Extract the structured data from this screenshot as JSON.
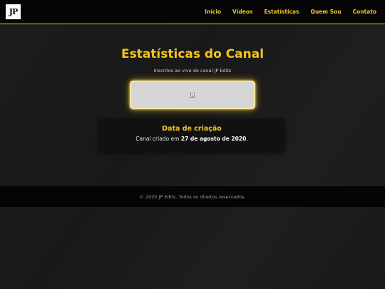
{
  "nav": {
    "logo_text": "JP",
    "links": [
      "Início",
      "Vídeos",
      "Estatísticas",
      "Quem Sou",
      "Contato"
    ]
  },
  "hero": {
    "title": "Estatísticas do Canal",
    "subtitle": "Inscritos ao vivo do canal JP Edits"
  },
  "counter": {
    "icon": "broken-image-icon"
  },
  "card": {
    "title": "Data de criação",
    "text_prefix": "Canal criado em ",
    "date": "27 de agosto de 2020",
    "text_suffix": "."
  },
  "footer": {
    "text": "© 2025 JP Edits. Todos os direitos reservados."
  },
  "colors": {
    "accent": "#f4c51c",
    "background": "#1a1a1a",
    "navbar": "#050505"
  }
}
